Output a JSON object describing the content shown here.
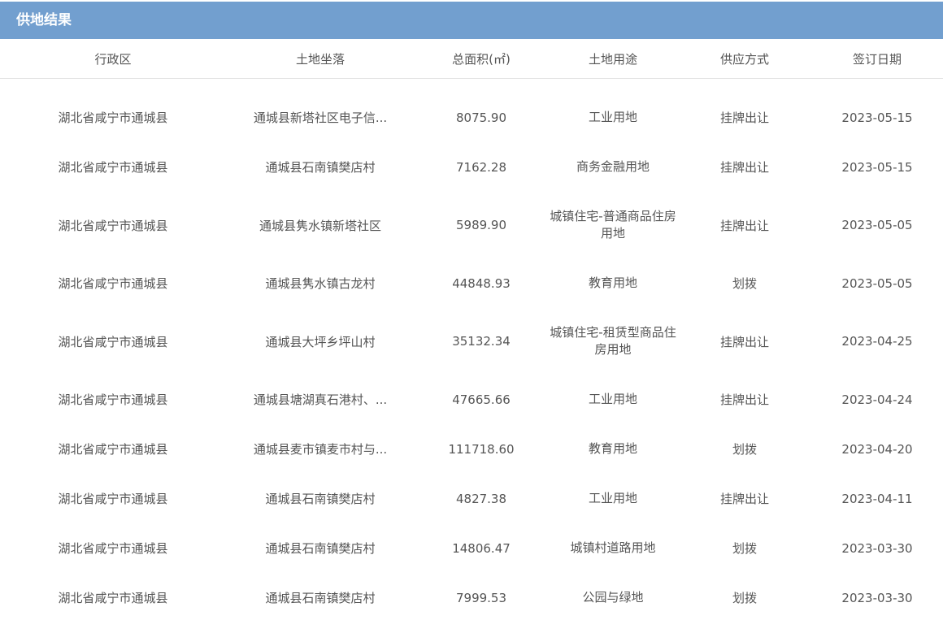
{
  "panel": {
    "title": "供地结果"
  },
  "table": {
    "headers": [
      "行政区",
      "土地坐落",
      "总面积(㎡)",
      "土地用途",
      "供应方式",
      "签订日期"
    ],
    "rows": [
      [
        "湖北省咸宁市通城县",
        "通城县新塔社区电子信...",
        "8075.90",
        "工业用地",
        "挂牌出让",
        "2023-05-15"
      ],
      [
        "湖北省咸宁市通城县",
        "通城县石南镇樊店村",
        "7162.28",
        "商务金融用地",
        "挂牌出让",
        "2023-05-15"
      ],
      [
        "湖北省咸宁市通城县",
        "通城县隽水镇新塔社区",
        "5989.90",
        "城镇住宅-普通商品住房用地",
        "挂牌出让",
        "2023-05-05"
      ],
      [
        "湖北省咸宁市通城县",
        "通城县隽水镇古龙村",
        "44848.93",
        "教育用地",
        "划拨",
        "2023-05-05"
      ],
      [
        "湖北省咸宁市通城县",
        "通城县大坪乡坪山村",
        "35132.34",
        "城镇住宅-租赁型商品住房用地",
        "挂牌出让",
        "2023-04-25"
      ],
      [
        "湖北省咸宁市通城县",
        "通城县塘湖真石港村、...",
        "47665.66",
        "工业用地",
        "挂牌出让",
        "2023-04-24"
      ],
      [
        "湖北省咸宁市通城县",
        "通城县麦市镇麦市村与...",
        "111718.60",
        "教育用地",
        "划拨",
        "2023-04-20"
      ],
      [
        "湖北省咸宁市通城县",
        "通城县石南镇樊店村",
        "4827.38",
        "工业用地",
        "挂牌出让",
        "2023-04-11"
      ],
      [
        "湖北省咸宁市通城县",
        "通城县石南镇樊店村",
        "14806.47",
        "城镇村道路用地",
        "划拨",
        "2023-03-30"
      ],
      [
        "湖北省咸宁市通城县",
        "通城县石南镇樊店村",
        "7999.53",
        "公园与绿地",
        "划拨",
        "2023-03-30"
      ]
    ]
  },
  "colors": {
    "header_bg": "#729fcf",
    "header_text": "#ffffff",
    "body_text": "#555555",
    "divider": "#e2e2e2"
  }
}
